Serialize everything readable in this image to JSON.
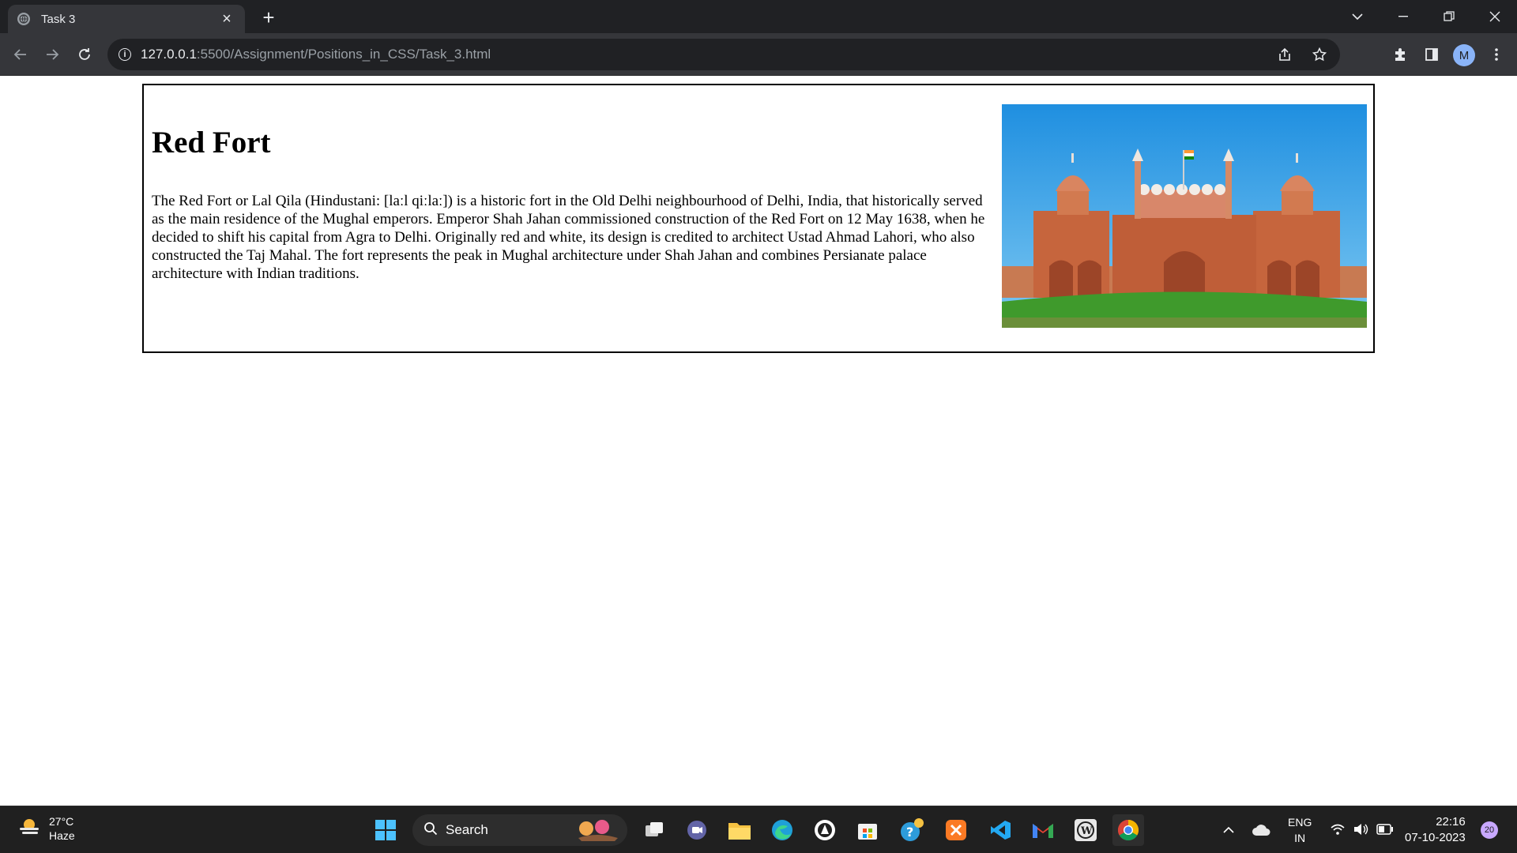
{
  "browser": {
    "tab_title": "Task 3",
    "url_host": "127.0.0.1",
    "url_path": ":5500/Assignment/Positions_in_CSS/Task_3.html",
    "profile_initial": "M"
  },
  "page": {
    "heading": "Red Fort",
    "paragraph": "The Red Fort or Lal Qila (Hindustani: [laːl qiːlaː]) is a historic fort in the Old Delhi neighbourhood of Delhi, India, that historically served as the main residence of the Mughal emperors. Emperor Shah Jahan commissioned construction of the Red Fort on 12 May 1638, when he decided to shift his capital from Agra to Delhi. Originally red and white, its design is credited to architect Ustad Ahmad Lahori, who also constructed the Taj Mahal. The fort represents the peak in Mughal architecture under Shah Jahan and combines Persianate palace architecture with Indian traditions."
  },
  "taskbar": {
    "weather_temp": "27°C",
    "weather_desc": "Haze",
    "search_label": "Search",
    "lang_primary": "ENG",
    "lang_secondary": "IN",
    "time": "22:16",
    "date": "07-10-2023",
    "notification_count": "20"
  },
  "colors": {
    "chrome_dark": "#202124",
    "chrome_toolbar": "#35363a",
    "taskbar": "#202020",
    "fort_red": "#c8643c",
    "sky_blue": "#3aa3e8"
  }
}
